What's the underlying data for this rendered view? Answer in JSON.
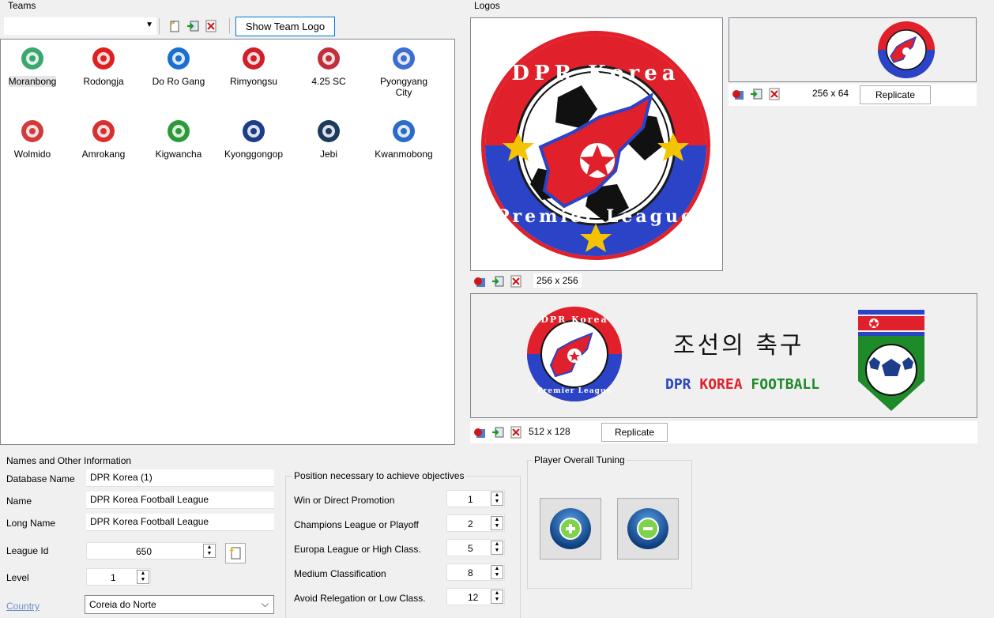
{
  "teams": {
    "title": "Teams",
    "dropdown_value": "",
    "show_logo_label": "Show Team Logo",
    "items": [
      {
        "name": "Moranbong",
        "color": "#3aa76d"
      },
      {
        "name": "Rodongja",
        "color": "#e02020"
      },
      {
        "name": "Do Ro Gang",
        "color": "#1a6fd1"
      },
      {
        "name": "Rimyongsu",
        "color": "#d0202a"
      },
      {
        "name": "4.25 SC",
        "color": "#c0303c"
      },
      {
        "name": "Pyongyang City",
        "color": "#3d6fd0"
      },
      {
        "name": "Wolmido",
        "color": "#d23b3b"
      },
      {
        "name": "Amrokang",
        "color": "#d83030"
      },
      {
        "name": "Kigwancha",
        "color": "#2d9a3a"
      },
      {
        "name": "Kyonggongop",
        "color": "#1c3d8a"
      },
      {
        "name": "Jebi",
        "color": "#1b3a5c"
      },
      {
        "name": "Kwanmobong",
        "color": "#2a6cc7"
      }
    ]
  },
  "logos": {
    "title": "Logos",
    "big": {
      "size": "256 x 256"
    },
    "small": {
      "size": "256 x 64",
      "replicate": "Replicate"
    },
    "wide": {
      "size": "512 x 128",
      "replicate": "Replicate"
    },
    "korean_text": "조선의 축구",
    "banner_dpr": "DPR ",
    "banner_korea": "KOREA ",
    "banner_football": "FOOTBALL",
    "badge_text": {
      "top": "DPR Korea",
      "bottom": "Premier League"
    }
  },
  "names": {
    "title": "Names and Other Information",
    "database_name_label": "Database Name",
    "database_name": "DPR Korea (1)",
    "name_label": "Name",
    "name": "DPR Korea Football League",
    "long_name_label": "Long Name",
    "long_name": "DPR Korea Football League",
    "league_id_label": "League Id",
    "league_id": "650",
    "level_label": "Level",
    "level": "1",
    "country_label": "Country",
    "country": "Coreia do Norte"
  },
  "objectives": {
    "title": "Position necessary to achieve objectives",
    "rows": [
      {
        "label": "Win or Direct Promotion",
        "value": "1"
      },
      {
        "label": "Champions League or Playoff",
        "value": "2"
      },
      {
        "label": "Europa League or High Class.",
        "value": "5"
      },
      {
        "label": "Medium Classification",
        "value": "8"
      },
      {
        "label": "Avoid Relegation or Low Class.",
        "value": "12"
      }
    ]
  },
  "tuning": {
    "title": "Player Overall Tuning"
  },
  "colors": {
    "accent": "#0078d7",
    "link": "#6d8fc7",
    "dpr_blue": "#2a43c7",
    "dpr_red": "#e0202a",
    "dpr_green": "#1f8a2a"
  }
}
